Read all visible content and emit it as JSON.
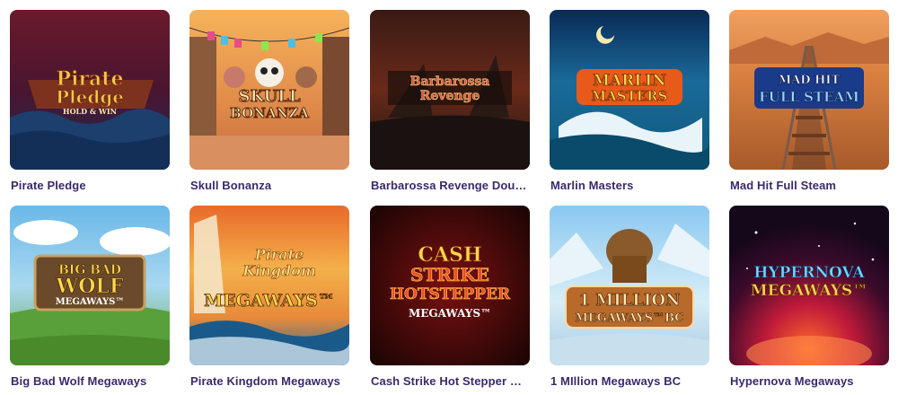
{
  "games": [
    {
      "title": "Pirate Pledge",
      "logo": [
        "Pirate",
        "Pledge",
        "HOLD & WIN"
      ]
    },
    {
      "title": "Skull Bonanza",
      "logo": [
        "SKULL",
        "BONANZA"
      ]
    },
    {
      "title": "Barbarossa Revenge Doub…",
      "logo": [
        "Barbarossa",
        "Revenge"
      ]
    },
    {
      "title": "Marlin Masters",
      "logo": [
        "MARLIN",
        "MASTERS"
      ]
    },
    {
      "title": "Mad Hit Full Steam",
      "logo": [
        "MAD HIT",
        "FULL STEAM"
      ]
    },
    {
      "title": "Big Bad Wolf Megaways",
      "logo": [
        "BIG BAD",
        "WOLF",
        "MEGAWAYS™"
      ]
    },
    {
      "title": "Pirate Kingdom Megaways",
      "logo": [
        "Pirate",
        "Kingdom",
        "MEGAWAYS™"
      ]
    },
    {
      "title": "Cash Strike Hot Stepper M…",
      "logo": [
        "CASH",
        "STRIKE",
        "HOTSTEPPER",
        "MEGAWAYS™"
      ]
    },
    {
      "title": "1 MIllion Megaways BC",
      "logo": [
        "1 MILLION",
        "MEGAWAYS™BC"
      ]
    },
    {
      "title": "Hypernova Megaways",
      "logo": [
        "HYPERNOVA",
        "MEGAWAYS™"
      ]
    }
  ],
  "colors": {
    "title_text": "#3a2a6b",
    "background": "#ffffff"
  }
}
